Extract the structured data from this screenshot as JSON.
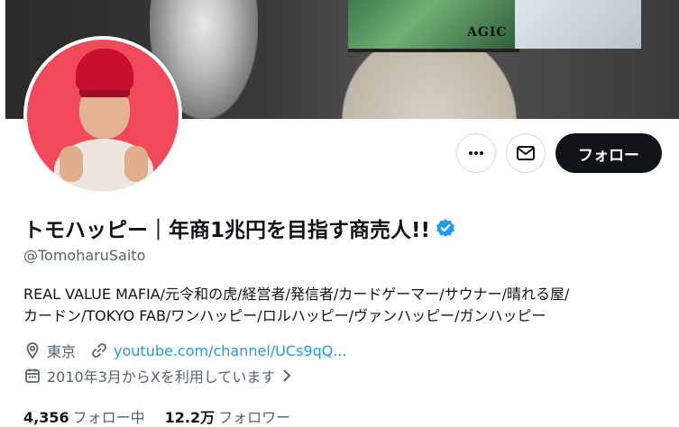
{
  "profile": {
    "name": "トモハッピー｜年商1兆円を目指す商売人!!",
    "handle": "@TomoharuSaito",
    "bio_line1": "REAL VALUE MAFIA/元令和の虎/経営者/発信者/カードゲーマー/サウナー/晴れる屋/",
    "bio_line2": "カードン/TOKYO FAB/ワンハッピー/ロルハッピー/ヴァンハッピー/ガンハッピー",
    "location": "東京",
    "website": "youtube.com/channel/UCs9qQ...",
    "joined": "2010年3月からXを利用しています",
    "verified_color": "#1d9bf0"
  },
  "banner": {
    "poster_text": "AGIC"
  },
  "actions": {
    "more_icon": "more-horizontal-icon",
    "message_icon": "mail-icon",
    "follow_label": "フォロー"
  },
  "stats": {
    "following_count": "4,356",
    "following_label": "フォロー中",
    "followers_count": "12.2万",
    "followers_label": "フォロワー"
  }
}
